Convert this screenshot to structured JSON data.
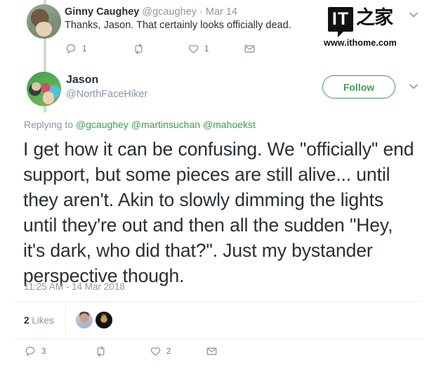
{
  "thread": {
    "parent_tweet": {
      "author_name": "Ginny Caughey",
      "author_handle": "@gcaughey",
      "separator": "·",
      "date": "Mar 14",
      "text": "Thanks, Jason. That certainly looks officially dead.",
      "avatar_name": "ginny-caughey-avatar",
      "actions": [
        {
          "icon": "reply-icon",
          "label": "Reply",
          "count": "1"
        },
        {
          "icon": "retweet-icon",
          "label": "Retweet",
          "count": ""
        },
        {
          "icon": "like-icon",
          "label": "Like",
          "count": "1"
        },
        {
          "icon": "direct-message-icon",
          "label": "Direct message",
          "count": ""
        }
      ]
    },
    "main_tweet": {
      "author_name": "Jason",
      "author_handle": "@NorthFaceHiker",
      "avatar_name": "jason-avatar",
      "follow_label": "Follow",
      "replying_prefix": "Replying to",
      "replying_mentions": [
        "@gcaughey",
        "@martinsuchan",
        "@mahoekst"
      ],
      "text": "I get how it can be confusing.  We \"officially\" end support, but some pieces are still alive... until they aren't.  Akin to slowly dimming the lights until they're out and then all the sudden \"Hey, it's dark, who did that?\".  Just my bystander perspective though.",
      "timestamp": "11:25 AM - 14 Mar 2018",
      "likes_count": "2",
      "likes_label": "Likes",
      "likers": [
        "liker-avatar-1",
        "liker-avatar-2"
      ],
      "actions": [
        {
          "icon": "reply-icon",
          "label": "Reply",
          "count": "3"
        },
        {
          "icon": "retweet-icon",
          "label": "Retweet",
          "count": ""
        },
        {
          "icon": "like-icon",
          "label": "Like",
          "count": "2"
        },
        {
          "icon": "direct-message-icon",
          "label": "Direct message",
          "count": ""
        }
      ]
    }
  },
  "watermark": {
    "badge_text": "IT",
    "cjk_text": "之家",
    "url": "www.ithome.com"
  },
  "colors": {
    "accent_green": "#3f9c52",
    "thread_line": "#cfdccf",
    "muted_text": "#8b98a5",
    "body_text": "#292f33",
    "divider": "#e6ecf0"
  }
}
